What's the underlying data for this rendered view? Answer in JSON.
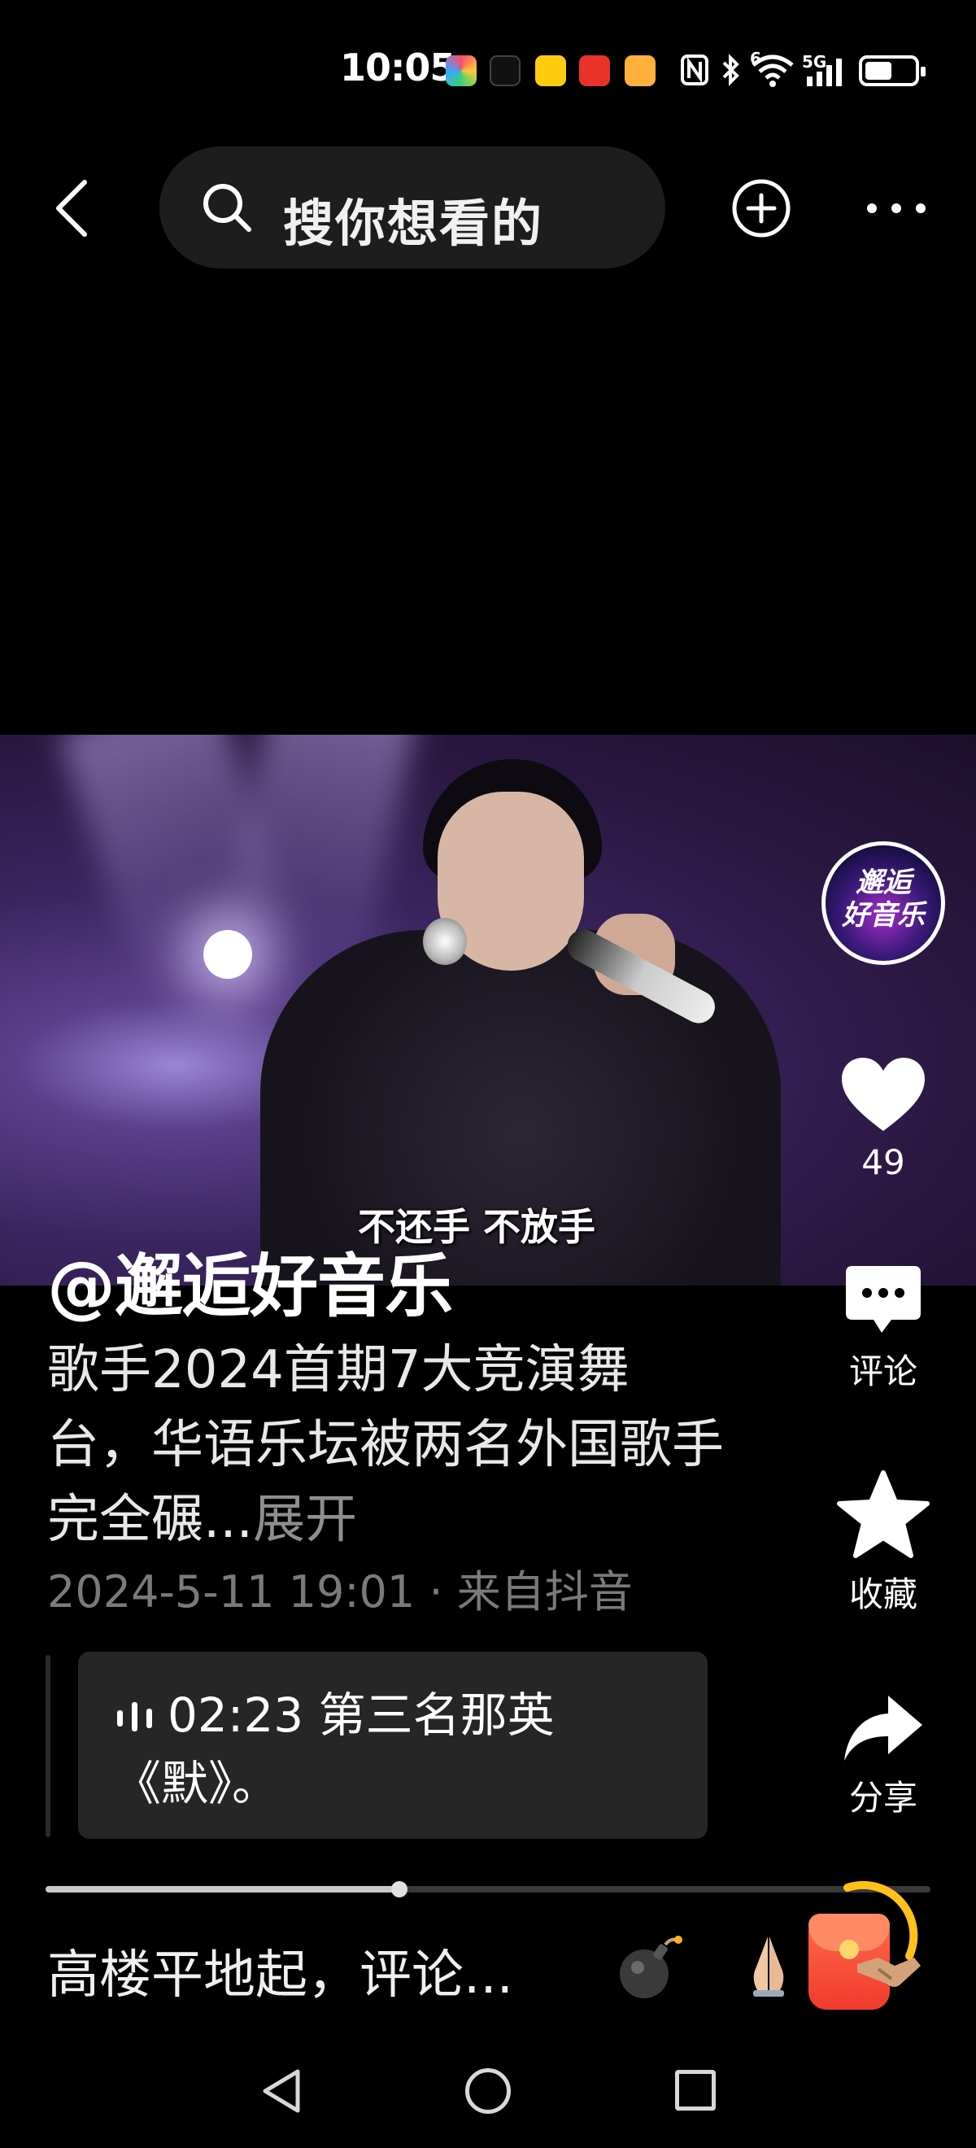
{
  "status_bar": {
    "time": "10:05",
    "app_icons": [
      "app-a-icon",
      "tiktok-icon",
      "meituan-icon",
      "app-red-icon",
      "app-panda-icon"
    ],
    "system_icons": [
      "nfc-icon",
      "bluetooth-icon",
      "wifi-icon",
      "signal-icon",
      "battery-icon"
    ],
    "network_label": "5G",
    "wifi_label": "6",
    "battery_level": 0.6
  },
  "top_nav": {
    "search_placeholder": "搜你想看的",
    "icons": [
      "back-icon",
      "search-icon",
      "add-icon",
      "more-icon"
    ]
  },
  "video": {
    "subtitle": "不还手 不放手"
  },
  "right_rail": {
    "avatar_text": "邂逅\n好音乐",
    "like_count": "49",
    "comment_label": "评论",
    "favorite_label": "收藏",
    "share_label": "分享"
  },
  "caption": {
    "author": "@邂逅好音乐",
    "description": "歌手2024首期7大竞演舞台，华语乐坛被两名外国歌手完全碾...",
    "expand": "展开",
    "meta": "2024-5-11 19:01 · 来自抖音"
  },
  "chapter": {
    "text": "02:23 第三名那英《默》。"
  },
  "playback": {
    "progress": 0.4
  },
  "comment_bar": {
    "prompt": "高楼平地起，评论...",
    "emoji_icons": [
      "bomb-icon",
      "pray-icon",
      "handshake-icon"
    ],
    "red_packet": "red-packet-icon"
  },
  "colors": {
    "background": "#000000",
    "search_bg": "#1d1d1d",
    "card_bg": "#262626",
    "muted_text": "#7a7a7a",
    "red_packet": "#f13b2c",
    "ring": "#ffc21a"
  }
}
